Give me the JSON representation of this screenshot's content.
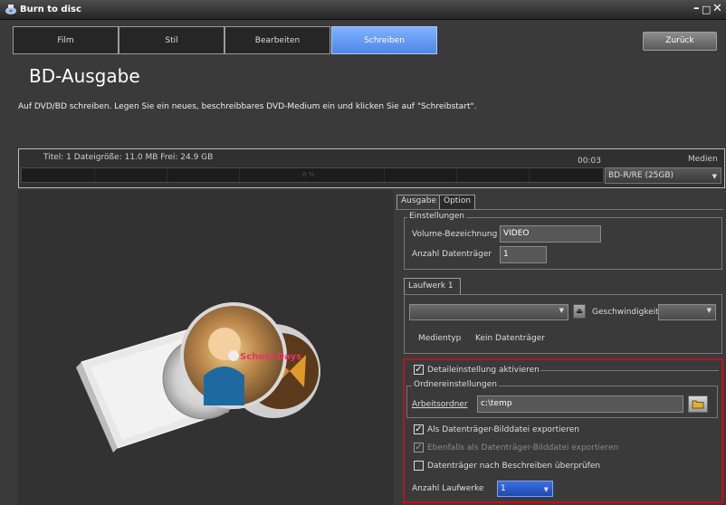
{
  "window": {
    "title": "Burn to disc",
    "controls": [
      "–",
      "□",
      "✕"
    ]
  },
  "nav": {
    "tabs": [
      {
        "label": "Film",
        "active": false
      },
      {
        "label": "Stil",
        "active": false
      },
      {
        "label": "Bearbeiten",
        "active": false
      },
      {
        "label": "Schreiben",
        "active": true
      }
    ],
    "back_label": "Zurück"
  },
  "page": {
    "title": "BD-Ausgabe",
    "instruction": "Auf DVD/BD schreiben. Legen Sie ein neues, beschreibbares DVD-Medium ein und klicken Sie auf \"Schreibstart\"."
  },
  "progress": {
    "info": "Titel: 1   Dateigröße: 11.0 MB   Frei: 24.9 GB",
    "time": "00:03",
    "percent_text": "0 %",
    "percent": 0,
    "media_label": "Medien",
    "media_value": "BD-R/RE (25GB)"
  },
  "settings_tabs": {
    "output": "Ausgabe",
    "option": "Option"
  },
  "einstellungen": {
    "title": "Einstellungen",
    "volume_label": "Volume-Bezeichnung",
    "volume_value": "VIDEO",
    "disc_count_label": "Anzahl Datenträger",
    "disc_count_value": "1"
  },
  "drive": {
    "tab": "Laufwerk 1",
    "speed_label": "Geschwindigkeit",
    "media_type_label": "Medientyp",
    "media_type_value": "Kein Datenträger"
  },
  "detail": {
    "enable_label": "Detaileinstellung aktivieren",
    "enable_checked": true,
    "folder_group": "Ordnereinstellungen",
    "work_folder_label": "Arbeitsordner",
    "work_folder_value": "c:\\temp",
    "export_image_label": "Als Datenträger-Bilddatei exportieren",
    "export_image_checked": true,
    "also_export_label": "Ebenfalls als Datenträger-Bilddatei exportieren",
    "also_export_checked": true,
    "verify_label": "Datenträger nach Beschreiben überprüfen",
    "verify_checked": false,
    "drive_count_label": "Anzahl Laufwerke",
    "drive_count_value": "1"
  },
  "preview": {
    "disc_text": "School Days"
  },
  "colors": {
    "active_tab": "#5a92f0",
    "highlight_border": "#b8141c",
    "background": "#3a3a3a"
  }
}
